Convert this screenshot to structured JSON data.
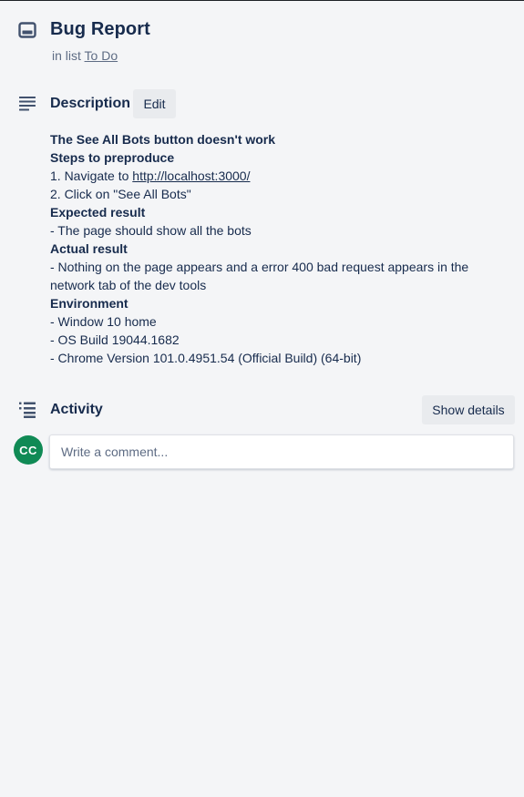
{
  "card": {
    "title": "Bug Report",
    "in_list_prefix": "in list",
    "list_name": "To Do"
  },
  "description": {
    "title": "Description",
    "edit_label": "Edit",
    "lines": [
      {
        "text": "The See All Bots button doesn't work",
        "bold": true
      },
      {
        "text": "Steps to preproduce",
        "bold": true
      },
      {
        "prefix": "1. Navigate to ",
        "link": "http://localhost:3000/"
      },
      {
        "text": "2. Click on \"See All Bots\""
      },
      {
        "text": "Expected result",
        "bold": true
      },
      {
        "text": "- The page should show all the bots"
      },
      {
        "text": "Actual result",
        "bold": true
      },
      {
        "text": "- Nothing on the page appears and a error 400 bad request appears in the network tab of the dev tools",
        "wrap": true
      },
      {
        "text": "Environment",
        "bold": true
      },
      {
        "text": "- Window 10 home"
      },
      {
        "text": "- OS Build 19044.1682"
      },
      {
        "text": "- Chrome Version 101.0.4951.54 (Official Build) (64-bit)"
      }
    ]
  },
  "activity": {
    "title": "Activity",
    "show_details_label": "Show details",
    "avatar_initials": "CC",
    "comment_placeholder": "Write a comment..."
  },
  "icons": {
    "card": "card-icon",
    "description": "description-icon",
    "activity": "activity-icon"
  },
  "colors": {
    "background": "#f4f5f7",
    "text": "#172b4d",
    "subtle_text": "#5e6c84",
    "button_bg": "#e9ebee",
    "avatar_bg": "#108a55"
  }
}
